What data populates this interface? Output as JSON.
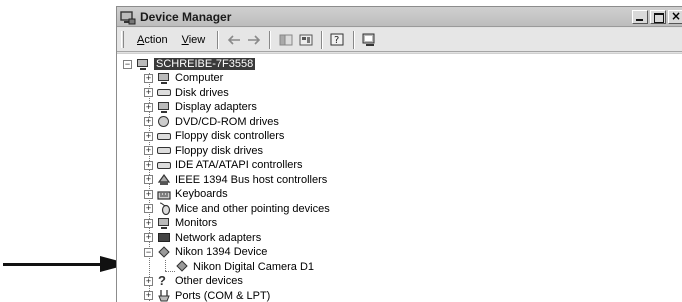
{
  "window": {
    "title": "Device Manager",
    "controls": {
      "close_glyph": "×"
    }
  },
  "toolbar": {
    "menus": [
      {
        "first": "A",
        "rest": "ction"
      },
      {
        "first": "V",
        "rest": "iew"
      }
    ],
    "buttons": [
      "back-icon",
      "forward-icon",
      "properties-icon",
      "show-hide-console-tree-icon",
      "help-icon",
      "scan-hardware-icon"
    ]
  },
  "tree": {
    "root": {
      "label": "SCHREIBE-7F3558",
      "icon": "computer-icon",
      "selected": true
    },
    "items": [
      {
        "label": "Computer",
        "icon": "computer-icon",
        "expander": "+"
      },
      {
        "label": "Disk drives",
        "icon": "disk-drive-icon",
        "expander": "+"
      },
      {
        "label": "Display adapters",
        "icon": "display-adapter-icon",
        "expander": "+"
      },
      {
        "label": "DVD/CD-ROM drives",
        "icon": "dvd-drive-icon",
        "expander": "+"
      },
      {
        "label": "Floppy disk controllers",
        "icon": "controller-icon",
        "expander": "+"
      },
      {
        "label": "Floppy disk drives",
        "icon": "floppy-drive-icon",
        "expander": "+"
      },
      {
        "label": "IDE ATA/ATAPI controllers",
        "icon": "controller-icon",
        "expander": "+"
      },
      {
        "label": "IEEE 1394 Bus host controllers",
        "icon": "firewire-icon",
        "expander": "+"
      },
      {
        "label": "Keyboards",
        "icon": "keyboard-icon",
        "expander": "+"
      },
      {
        "label": "Mice and other pointing devices",
        "icon": "mouse-icon",
        "expander": "+"
      },
      {
        "label": "Monitors",
        "icon": "monitor-icon",
        "expander": "+"
      },
      {
        "label": "Network adapters",
        "icon": "network-icon",
        "expander": "+"
      },
      {
        "label": "Nikon 1394 Device",
        "icon": "nikon-device-icon",
        "expander": "−"
      },
      {
        "label": "Nikon Digital Camera D1",
        "icon": "camera-device-icon",
        "child": true
      },
      {
        "label": "Other devices",
        "icon": "unknown-device-icon",
        "expander": "+"
      },
      {
        "label": "Ports (COM & LPT)",
        "icon": "port-icon",
        "expander": "+"
      }
    ]
  }
}
